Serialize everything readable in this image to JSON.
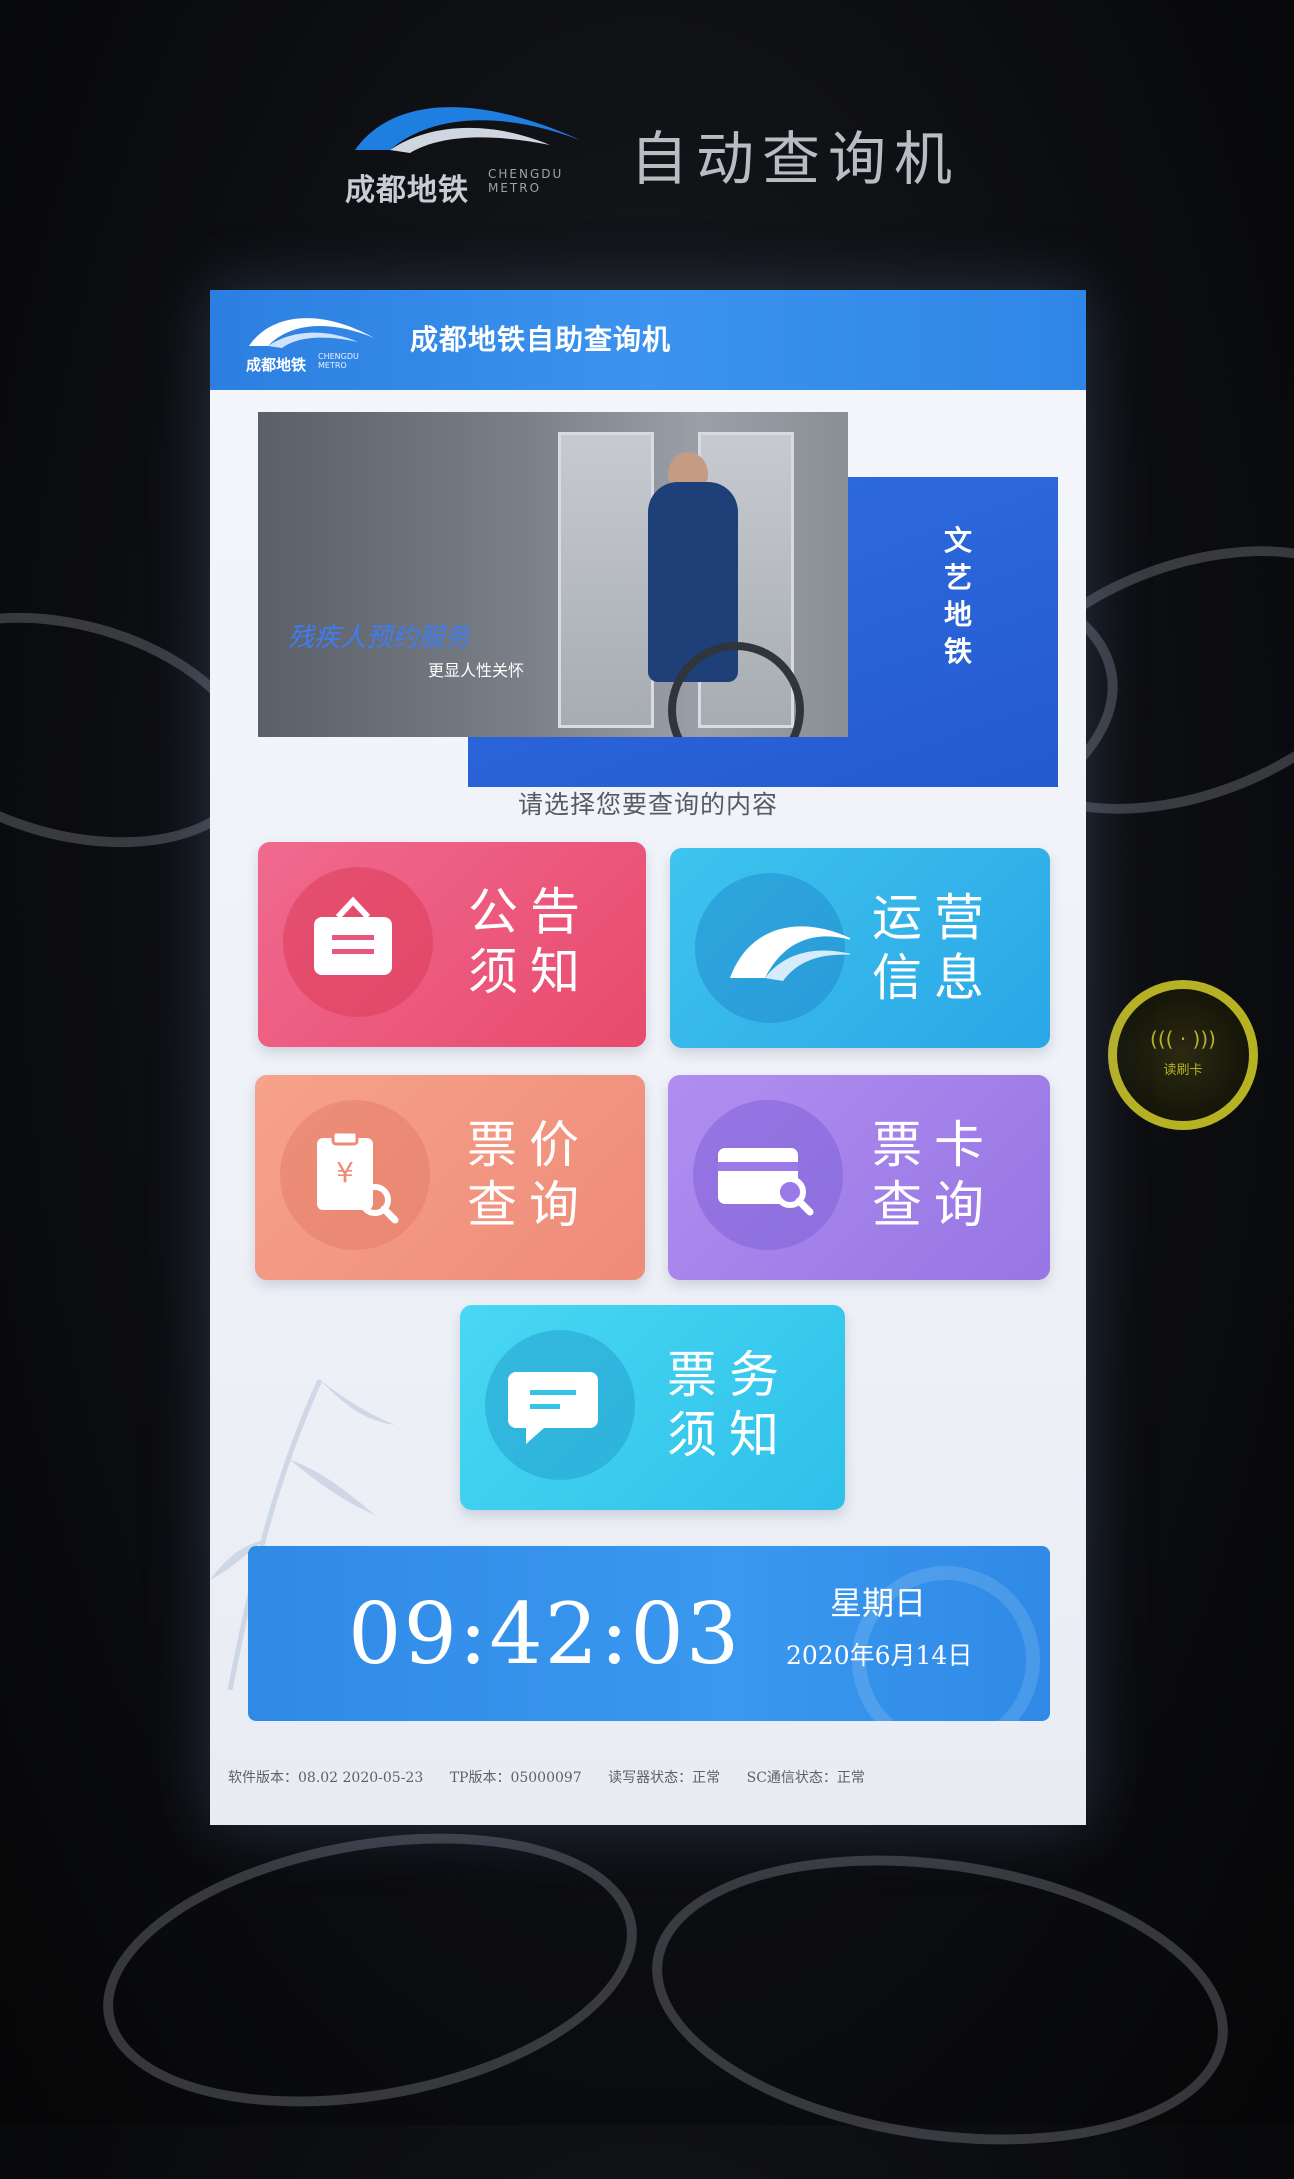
{
  "housing": {
    "logo_text": "成都地铁",
    "logo_sub_1": "CHENGDU",
    "logo_sub_2": "METRO",
    "title": "自动查询机"
  },
  "card_reader": {
    "label": "读刷卡",
    "waves": "((( · )))"
  },
  "screen": {
    "header": {
      "logo_text": "成都地铁",
      "logo_sub_1": "CHENGDU",
      "logo_sub_2": "METRO",
      "title": "成都地铁自助查询机"
    },
    "banner": {
      "caption": "残疾人预约服务",
      "subcaption": "更显人性关怀",
      "side_text": "文艺地铁"
    },
    "prompt": "请选择您要查询的内容",
    "tiles": [
      {
        "key": "notice",
        "label": "公告须知",
        "icon": "clipboard-icon",
        "color": "#e84a6d"
      },
      {
        "key": "ops",
        "label": "运营信息",
        "icon": "metro-logo-icon",
        "color": "#2aa6e6"
      },
      {
        "key": "fare",
        "label": "票价查询",
        "icon": "fare-search-icon",
        "color": "#ee8b78"
      },
      {
        "key": "card",
        "label": "票卡查询",
        "icon": "card-search-icon",
        "color": "#9775e4"
      },
      {
        "key": "ticket",
        "label": "票务须知",
        "icon": "chat-bubble-icon",
        "color": "#2fc0ea"
      }
    ],
    "clock": {
      "time": "09:42:03",
      "weekday": "星期日",
      "date": "2020年6月14日"
    },
    "status": {
      "software_version": "软件版本：08.02 2020-05-23",
      "tp_version": "TP版本：05000097",
      "reader_status": "读写器状态：正常",
      "sc_status": "SC通信状态：正常"
    }
  }
}
